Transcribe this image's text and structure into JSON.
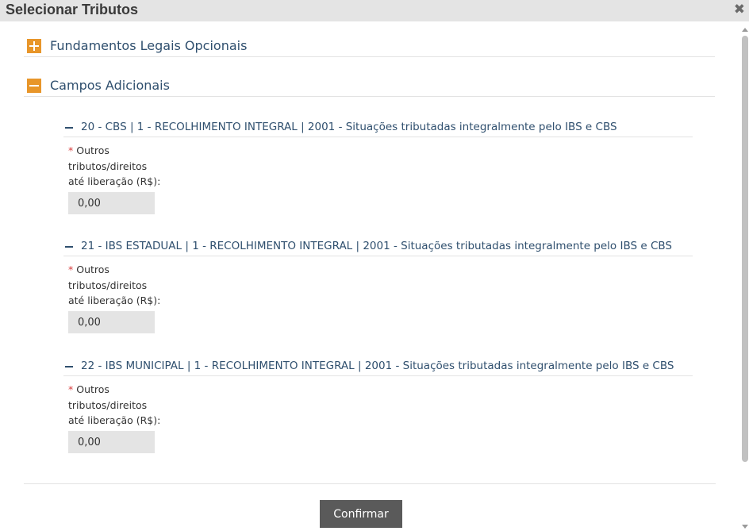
{
  "dialog": {
    "title": "Selecionar Tributos",
    "close_glyph": "✖"
  },
  "sections": [
    {
      "label": "Fundamentos Legais Opcionais",
      "state": "collapsed",
      "icon": "plus-icon"
    },
    {
      "label": "Campos Adicionais",
      "state": "expanded",
      "icon": "minus-icon"
    }
  ],
  "tax_groups": [
    {
      "header": "20 - CBS | 1 - RECOLHIMENTO INTEGRAL | 2001 - Situações tributadas integralmente pelo IBS e CBS",
      "required_mark": "*",
      "field_label_lines": [
        "Outros",
        "tributos/direitos",
        "até liberação (R$):"
      ],
      "value": "0,00"
    },
    {
      "header": "21 - IBS ESTADUAL | 1 - RECOLHIMENTO INTEGRAL | 2001 - Situações tributadas integralmente pelo IBS e CBS",
      "required_mark": "*",
      "field_label_lines": [
        "Outros",
        "tributos/direitos",
        "até liberação (R$):"
      ],
      "value": "0,00"
    },
    {
      "header": "22 - IBS MUNICIPAL | 1 - RECOLHIMENTO INTEGRAL | 2001 - Situações tributadas integralmente pelo IBS e CBS",
      "required_mark": "*",
      "field_label_lines": [
        "Outros",
        "tributos/direitos",
        "até liberação (R$):"
      ],
      "value": "0,00"
    }
  ],
  "footer": {
    "confirm_label": "Confirmar"
  },
  "colors": {
    "accent": "#e8962a",
    "heading_text": "#2f4f6e",
    "required": "#d63b3b",
    "button_bg": "#5a5a5a"
  }
}
